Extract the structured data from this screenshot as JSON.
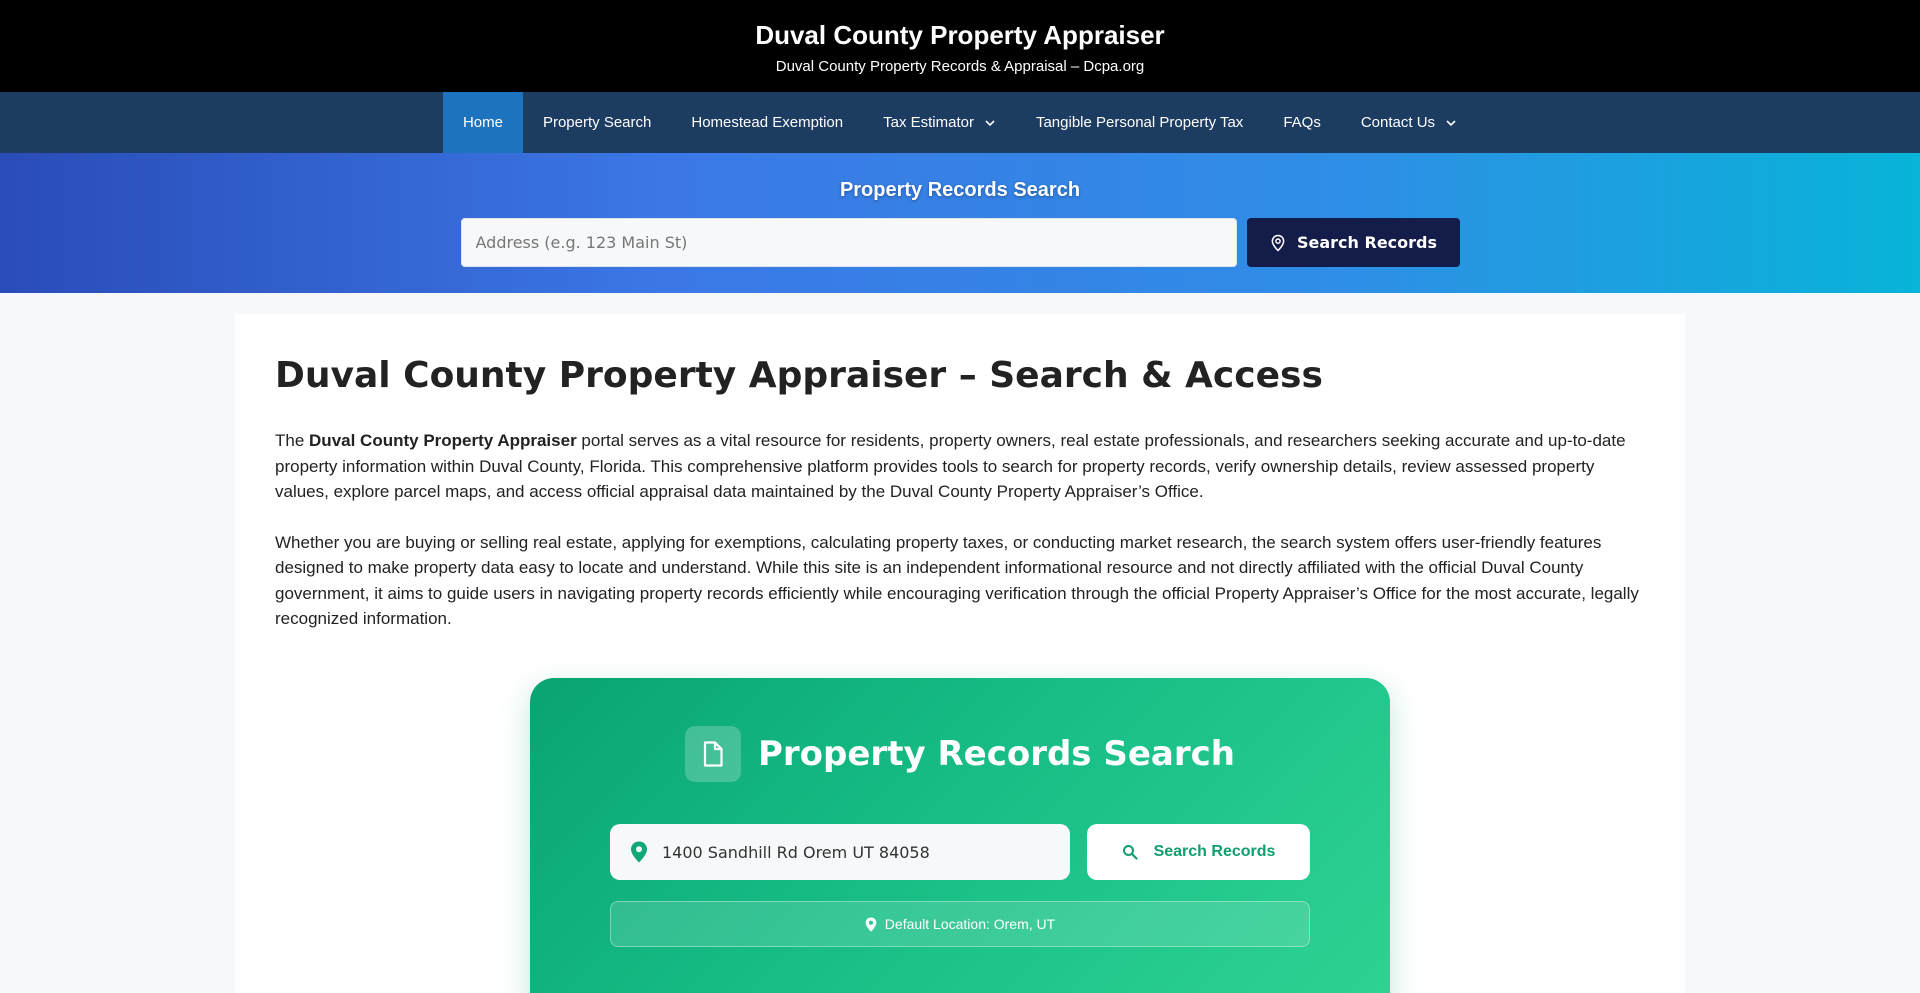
{
  "site": {
    "title": "Duval County Property Appraiser",
    "description": "Duval County Property Records & Appraisal – Dcpa.org"
  },
  "nav": {
    "items": [
      {
        "label": "Home",
        "active": true
      },
      {
        "label": "Property Search"
      },
      {
        "label": "Homestead Exemption"
      },
      {
        "label": "Tax Estimator",
        "dropdown": true
      },
      {
        "label": "Tangible Personal Property Tax"
      },
      {
        "label": "FAQs"
      },
      {
        "label": "Contact Us",
        "dropdown": true
      }
    ]
  },
  "hero": {
    "title": "Property Records Search",
    "input_placeholder": "Address (e.g. 123 Main St)",
    "button_label": "Search Records"
  },
  "article": {
    "title": "Duval County Property Appraiser – Search & Access",
    "p1_lead": "The ",
    "p1_bold": "Duval County Property Appraiser",
    "p1_rest": " portal serves as a vital resource for residents, property owners, real estate professionals, and researchers seeking accurate and up-to-date property information within Duval County, Florida. This comprehensive platform provides tools to search for property records, verify ownership details, review assessed property values, explore parcel maps, and access official appraisal data maintained by the Duval County Property Appraiser’s Office.",
    "p2": "Whether you are buying or selling real estate, applying for exemptions, calculating property taxes, or conducting market research, the search system offers user-friendly features designed to make property data easy to locate and understand. While this site is an independent informational resource and not directly affiliated with the official Duval County government, it aims to guide users in navigating property records efficiently while encouraging verification through the official Property Appraiser’s Office for the most accurate, legally recognized information."
  },
  "card": {
    "title": "Property Records Search",
    "input_value": "1400 Sandhill Rd Orem UT 84058",
    "button_label": "Search Records",
    "default_location": "Default Location: Orem, UT"
  },
  "colors": {
    "header_bg": "#000000",
    "nav_bg": "#1c3c61",
    "nav_active": "#1e73be",
    "hero_btn": "#141c4a",
    "card_green": "#17bd85"
  }
}
